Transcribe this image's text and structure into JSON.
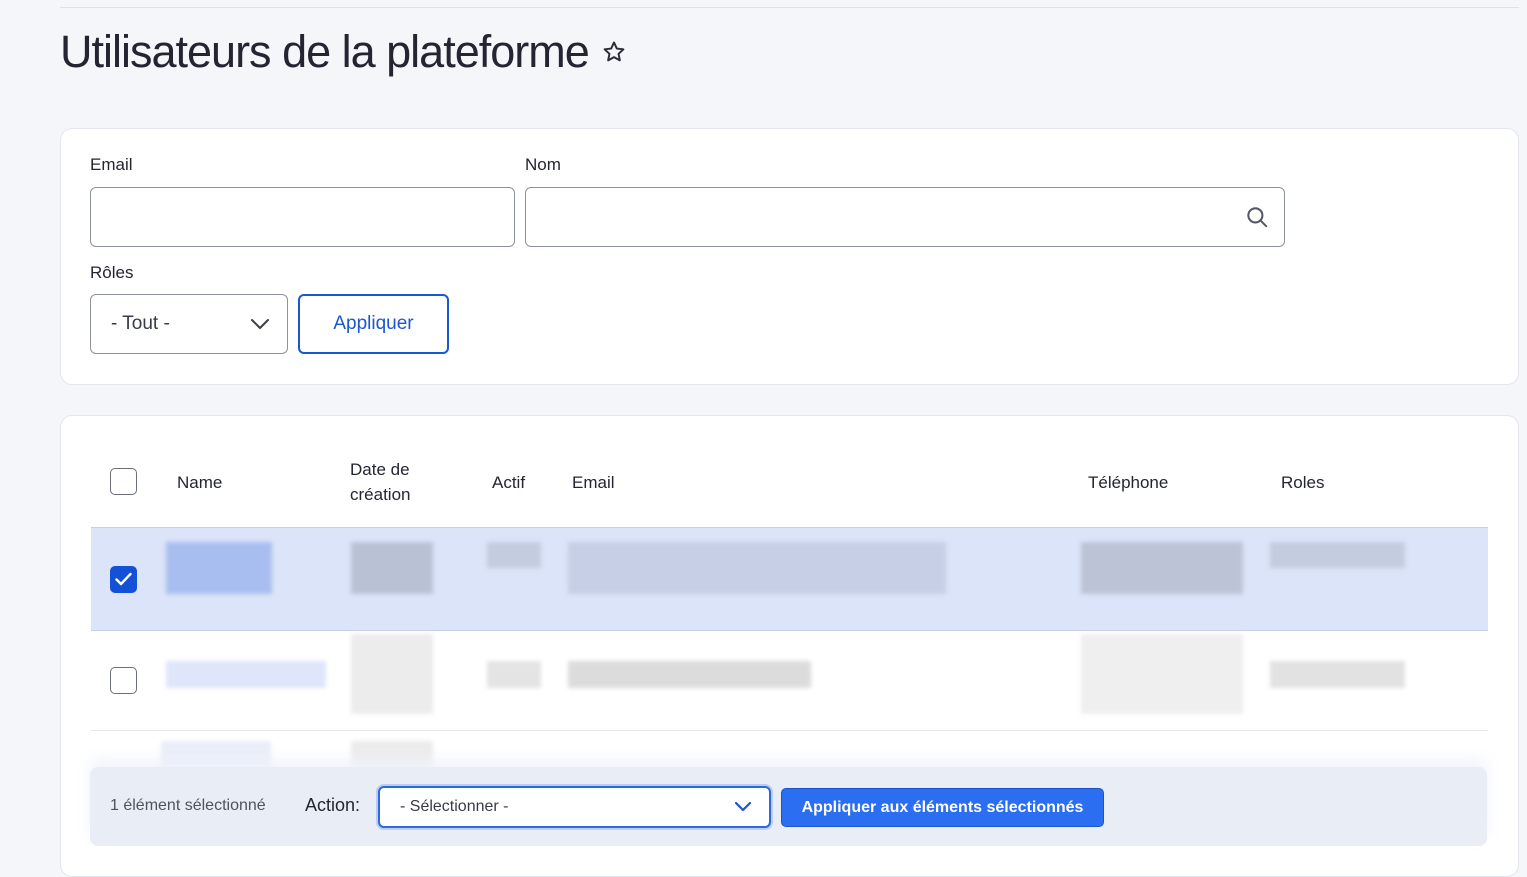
{
  "page": {
    "title": "Utilisateurs de la plateforme"
  },
  "filters": {
    "email_label": "Email",
    "email_value": "",
    "name_label": "Nom",
    "name_value": "",
    "roles_label": "Rôles",
    "roles_selected": "- Tout -",
    "apply_label": "Appliquer"
  },
  "table": {
    "columns": [
      "Name",
      "Date de création",
      "Actif",
      "Email",
      "Téléphone",
      "Roles"
    ],
    "rows": [
      {
        "selected": true,
        "redacted": true
      },
      {
        "selected": false,
        "redacted": true
      }
    ]
  },
  "bulk_actions": {
    "selection_text": "1 élément sélectionné",
    "action_label": "Action:",
    "action_selected": "- Sélectionner -",
    "apply_label": "Appliquer aux éléments sélectionnés"
  },
  "colors": {
    "accent": "#1a57d1",
    "primary_button": "#2b6ef2",
    "selected_row": "#dbe4f8",
    "background": "#f4f6fa"
  },
  "icons": [
    "star-icon",
    "search-icon",
    "chevron-down-icon",
    "check-icon"
  ]
}
